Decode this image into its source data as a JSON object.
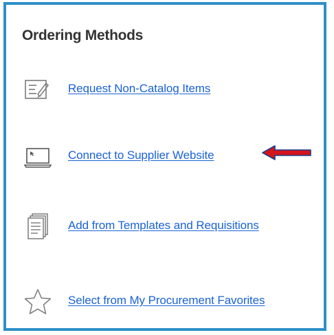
{
  "panel": {
    "title": "Ordering Methods",
    "items": [
      {
        "label": "Request Non-Catalog Items",
        "icon": "edit-form-icon"
      },
      {
        "label": "Connect to Supplier Website",
        "icon": "laptop-cursor-icon"
      },
      {
        "label": "Add from Templates and Requisitions",
        "icon": "stacked-documents-icon"
      },
      {
        "label": "Select from My Procurement Favorites",
        "icon": "star-outline-icon"
      }
    ]
  },
  "annotation": {
    "arrow_color": "#d3141c",
    "arrow_outline": "#1b3e8a"
  },
  "colors": {
    "border": "#2c8fc7",
    "link": "#1a62d6",
    "title": "#333333"
  }
}
